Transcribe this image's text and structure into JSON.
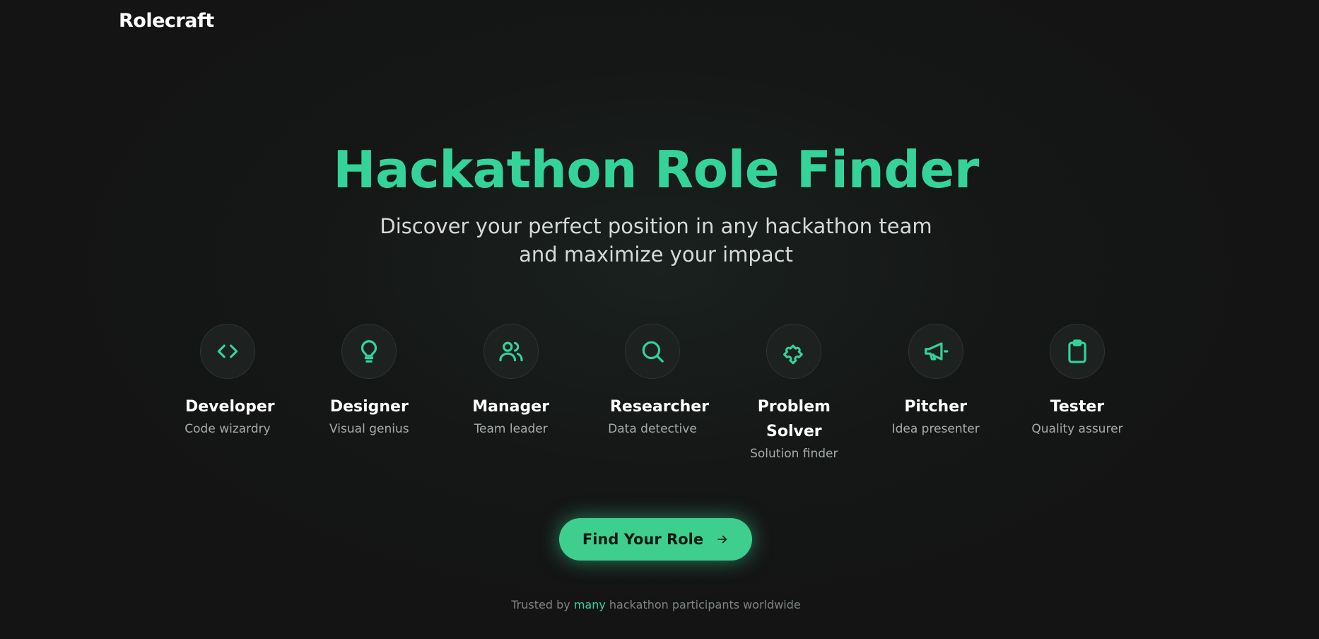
{
  "brand": {
    "name": "Rolecraft"
  },
  "hero": {
    "title": "Hackathon Role Finder",
    "subtitle": "Discover your perfect position in any hackathon team and maximize your impact"
  },
  "roles": [
    {
      "name": "Developer",
      "description": "Code wizardry",
      "icon": "code-icon"
    },
    {
      "name": "Designer",
      "description": "Visual genius",
      "icon": "lightbulb-icon"
    },
    {
      "name": "Manager",
      "description": "Team leader",
      "icon": "users-icon"
    },
    {
      "name": "Researcher",
      "description": "Data detective",
      "icon": "search-icon"
    },
    {
      "name": "Problem Solver",
      "description": "Solution finder",
      "icon": "puzzle-icon"
    },
    {
      "name": "Pitcher",
      "description": "Idea presenter",
      "icon": "megaphone-icon"
    },
    {
      "name": "Tester",
      "description": "Quality assurer",
      "icon": "clipboard-icon"
    }
  ],
  "cta": {
    "label": "Find Your Role",
    "icon": "arrow-right-icon"
  },
  "trust": {
    "prefix": "Trusted by",
    "highlight": "many",
    "suffix": "hackathon participants worldwide"
  },
  "colors": {
    "accent": "#34d399",
    "button": "#3ecf8e",
    "background": "#141414"
  }
}
